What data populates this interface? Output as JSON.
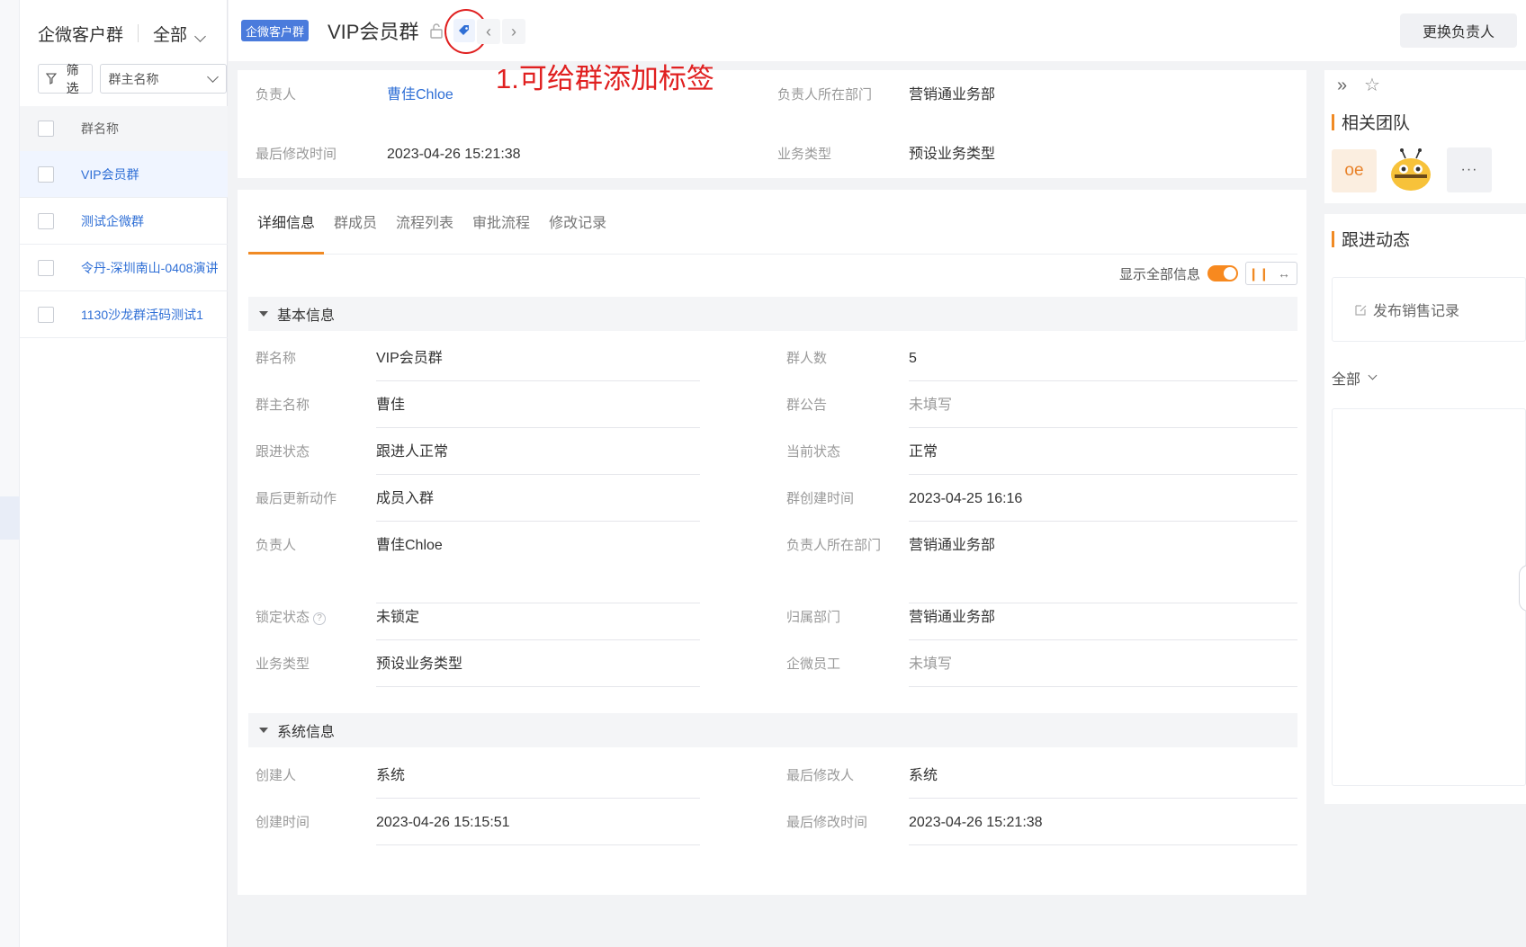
{
  "left_panel": {
    "title": "企微客户群",
    "scope": "全部",
    "filter_button": "筛选",
    "filter_field": "群主名称",
    "column_header": "群名称",
    "groups": [
      "VIP会员群",
      "测试企微群",
      "令丹-深圳南山-0408演讲",
      "1130沙龙群活码测试1"
    ]
  },
  "header": {
    "type_badge": "企微客户群",
    "title": "VIP会员群",
    "change_owner_button": "更换负责人",
    "annotation": "1.可给群添加标签"
  },
  "summary": {
    "owner_label": "负责人",
    "owner_value": "曹佳Chloe",
    "dept_label": "负责人所在部门",
    "dept_value": "营销通业务部",
    "modified_label": "最后修改时间",
    "modified_value": "2023-04-26 15:21:38",
    "biz_label": "业务类型",
    "biz_value": "预设业务类型"
  },
  "tabs": [
    "详细信息",
    "群成员",
    "流程列表",
    "审批流程",
    "修改记录"
  ],
  "show_all_label": "显示全部信息",
  "sections": {
    "basic": {
      "title": "基本信息",
      "fields": [
        {
          "label": "群名称",
          "value": "VIP会员群"
        },
        {
          "label": "群人数",
          "value": "5"
        },
        {
          "label": "群主名称",
          "value": "曹佳"
        },
        {
          "label": "群公告",
          "value": "未填写"
        },
        {
          "label": "跟进状态",
          "value": "跟进人正常"
        },
        {
          "label": "当前状态",
          "value": "正常"
        },
        {
          "label": "最后更新动作",
          "value": "成员入群"
        },
        {
          "label": "群创建时间",
          "value": "2023-04-25 16:16"
        },
        {
          "label": "负责人",
          "value": "曹佳Chloe"
        },
        {
          "label": "负责人所在部门",
          "value": "营销通业务部"
        },
        {
          "label": "锁定状态",
          "value": "未锁定"
        },
        {
          "label": "归属部门",
          "value": "营销通业务部"
        },
        {
          "label": "业务类型",
          "value": "预设业务类型"
        },
        {
          "label": "企微员工",
          "value": "未填写"
        }
      ]
    },
    "system": {
      "title": "系统信息",
      "fields": [
        {
          "label": "创建人",
          "value": "系统"
        },
        {
          "label": "最后修改人",
          "value": "系统"
        },
        {
          "label": "创建时间",
          "value": "2023-04-26 15:15:51"
        },
        {
          "label": "最后修改时间",
          "value": "2023-04-26 15:21:38"
        }
      ]
    }
  },
  "right_panel": {
    "team_title": "相关团队",
    "avatar_initials": "oe",
    "more_label": "···",
    "feed_title": "跟进动态",
    "publish_button": "发布销售记录",
    "feed_filter": "全部"
  },
  "colors": {
    "accent": "#f08a24",
    "link": "#2f6fd6",
    "badge": "#4a7bdc",
    "annotation": "#e02020"
  }
}
